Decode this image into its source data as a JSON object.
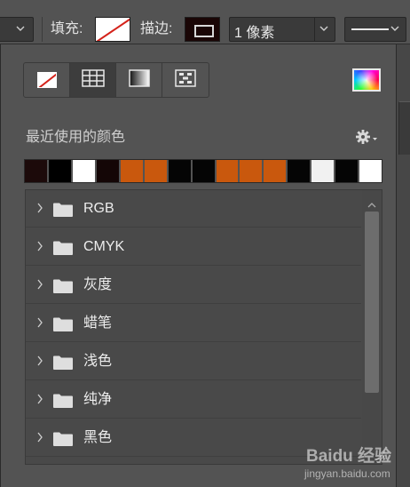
{
  "options_bar": {
    "fill_label": "填充:",
    "stroke_label": "描边:",
    "stroke_width_value": "1 像素",
    "fill_state": "none",
    "stroke_color": "#1a0606"
  },
  "swatches_panel": {
    "mode_buttons": [
      "none",
      "solid",
      "gradient",
      "pattern"
    ],
    "active_mode": "solid",
    "recent_colors_label": "最近使用的颜色",
    "recent_colors": [
      "#1c0a0a",
      "#000000",
      "#ffffff",
      "#140606",
      "#c9580d",
      "#c9580d",
      "#050505",
      "#050505",
      "#c9580d",
      "#c9580d",
      "#c9580d",
      "#050505",
      "#f1f1f1",
      "#050505",
      "#ffffff"
    ],
    "groups": [
      "RGB",
      "CMYK",
      "灰度",
      "蜡笔",
      "浅色",
      "纯净",
      "黑色"
    ]
  },
  "watermark": {
    "brand": "Baidu 经验",
    "url": "jingyan.baidu.com"
  }
}
